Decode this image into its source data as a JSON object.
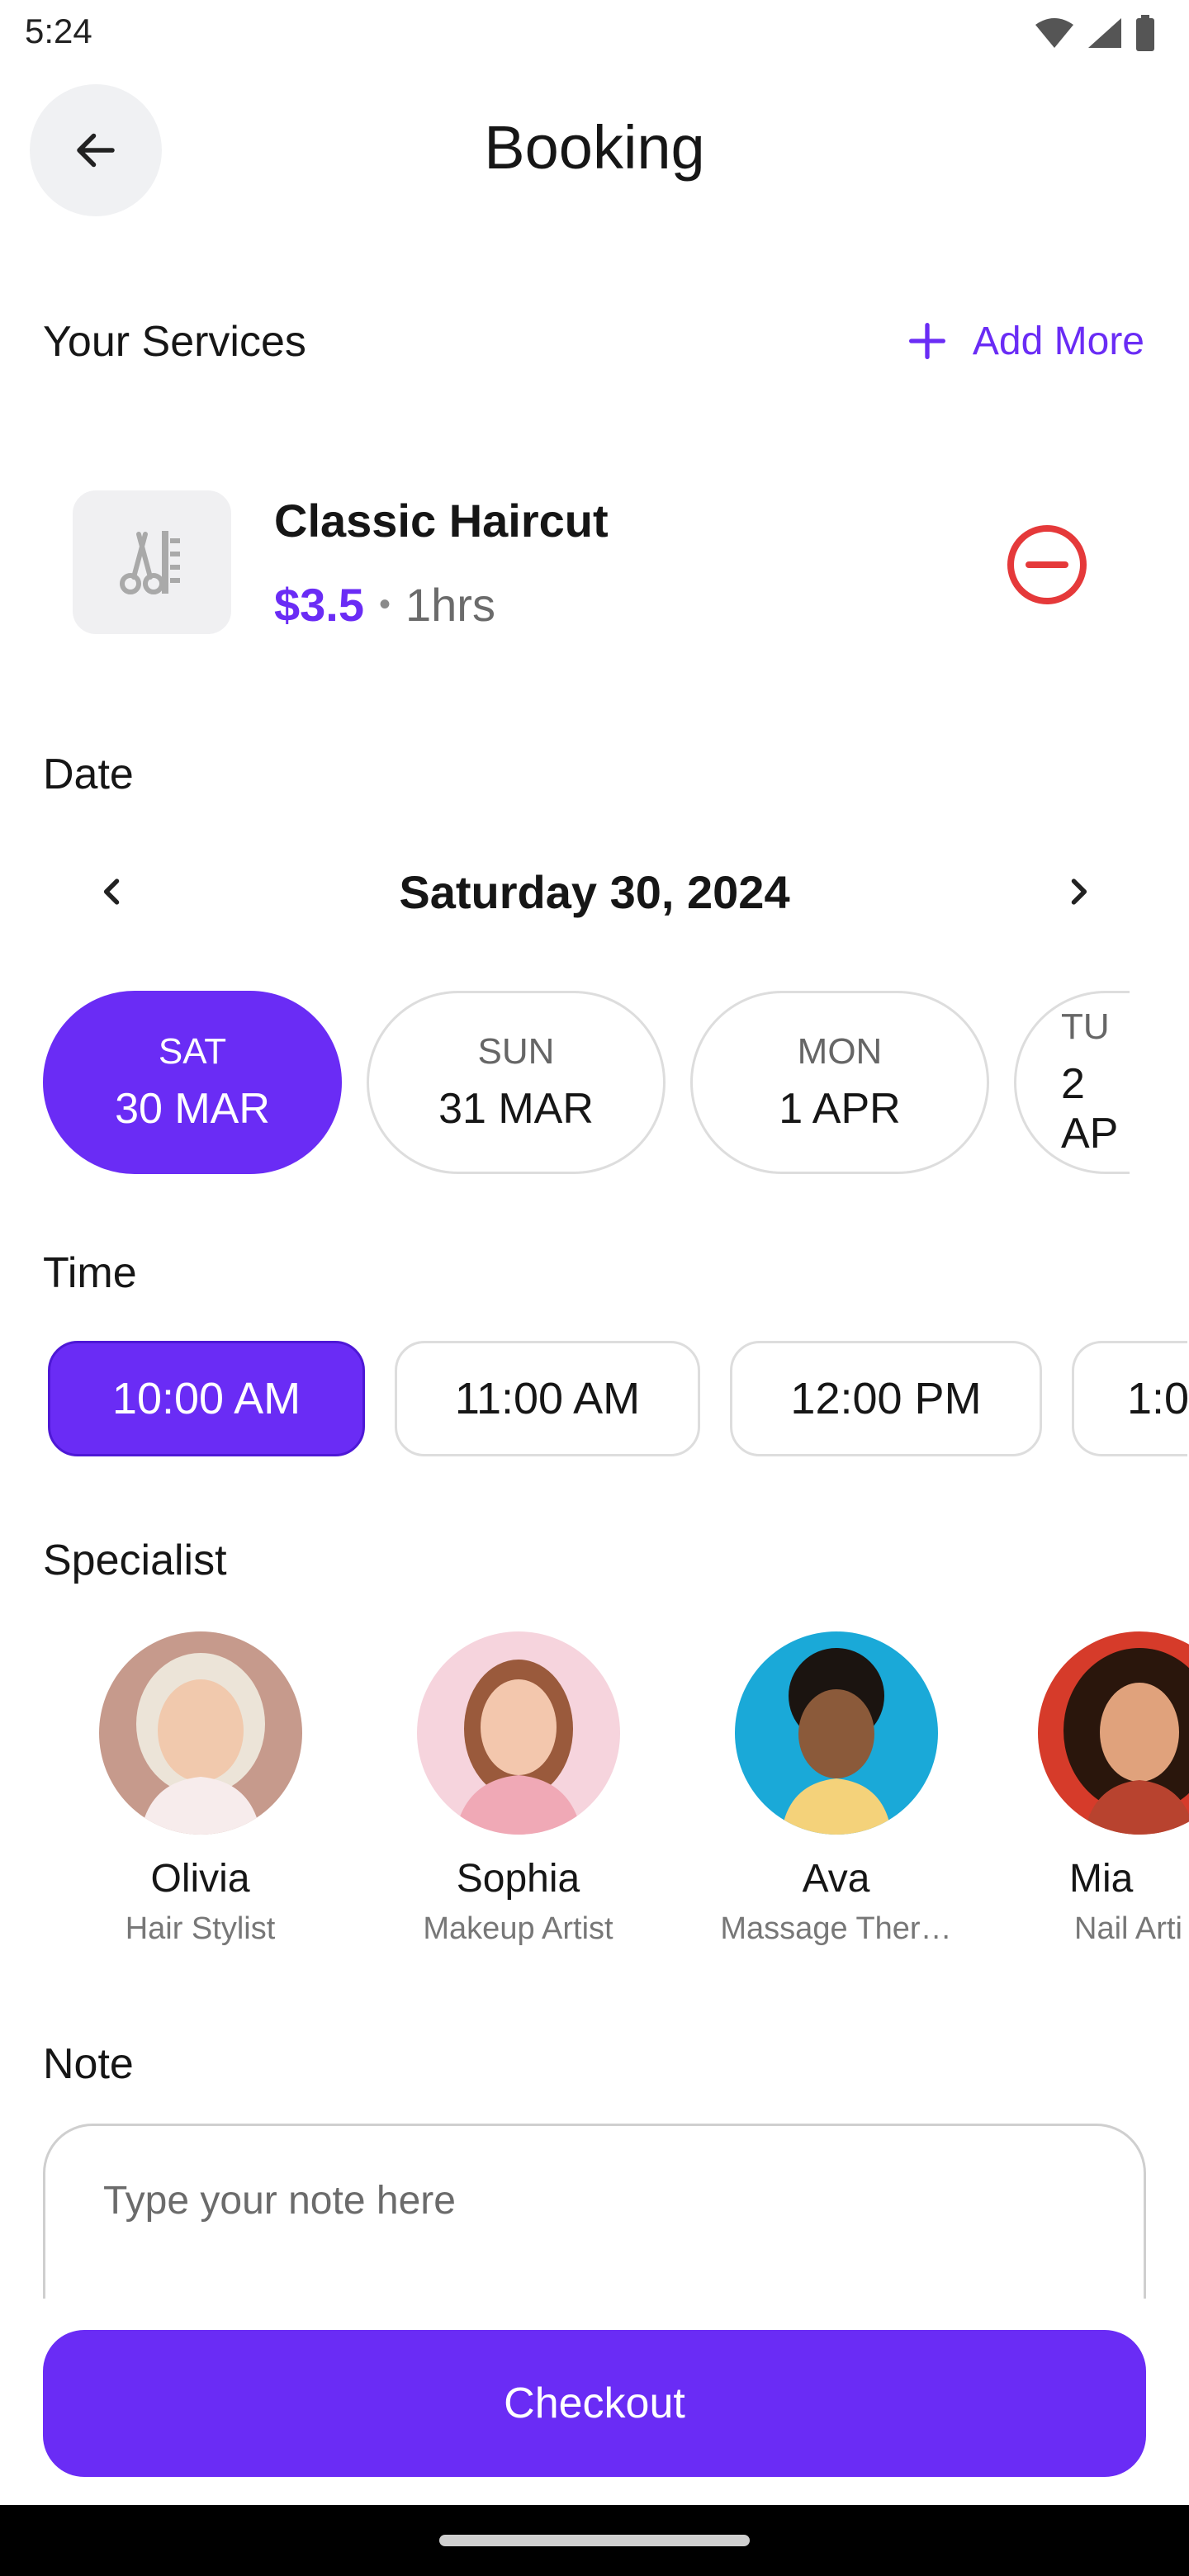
{
  "status_bar": {
    "time": "5:24"
  },
  "header": {
    "title": "Booking"
  },
  "services": {
    "title": "Your Services",
    "add_more_label": "Add More",
    "item": {
      "name": "Classic Haircut",
      "price": "$3.5",
      "separator": "•",
      "duration": "1hrs"
    }
  },
  "date": {
    "title": "Date",
    "current_label": "Saturday 30, 2024",
    "days": [
      {
        "dow": "SAT",
        "date": "30 MAR",
        "selected": true
      },
      {
        "dow": "SUN",
        "date": "31 MAR",
        "selected": false
      },
      {
        "dow": "MON",
        "date": "1 APR",
        "selected": false
      },
      {
        "dow": "TU",
        "date": "2 AP",
        "selected": false
      }
    ]
  },
  "time": {
    "title": "Time",
    "slots": [
      {
        "label": "10:00 AM",
        "selected": true
      },
      {
        "label": "11:00 AM",
        "selected": false
      },
      {
        "label": "12:00 PM",
        "selected": false
      },
      {
        "label": "1:0",
        "selected": false
      }
    ]
  },
  "specialist": {
    "title": "Specialist",
    "people": [
      {
        "name": "Olivia",
        "role": "Hair Stylist"
      },
      {
        "name": "Sophia",
        "role": "Makeup Artist"
      },
      {
        "name": "Ava",
        "role": "Massage Ther…"
      },
      {
        "name": "Mia",
        "role": "Nail Arti"
      }
    ]
  },
  "note": {
    "title": "Note",
    "placeholder": "Type your note here"
  },
  "checkout_label": "Checkout",
  "colors": {
    "accent": "#6a2cf5",
    "remove": "#e5393a"
  }
}
